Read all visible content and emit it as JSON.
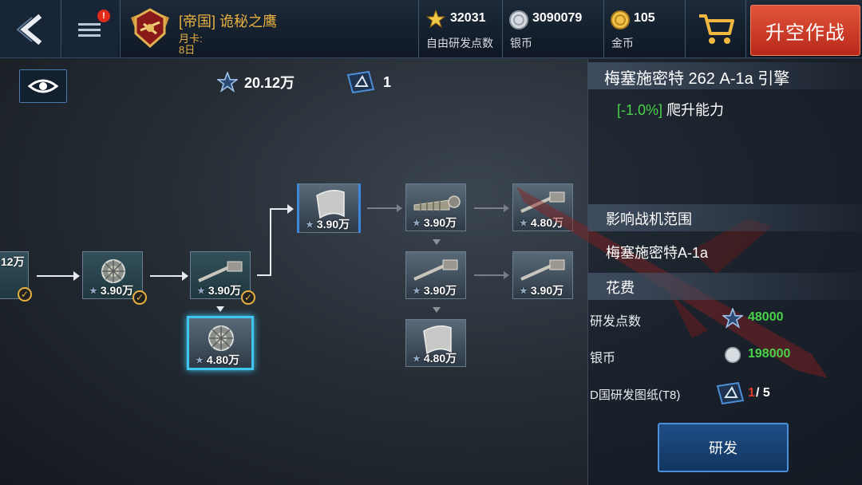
{
  "topbar": {
    "player": {
      "faction": "[帝国]",
      "name": "诡秘之鹰",
      "monthly_card_label": "月卡:",
      "monthly_card_days": "8日"
    },
    "menu_notification": "!",
    "resources": [
      {
        "value": "32031",
        "label": "自由研发点数",
        "icon": "star-icon"
      },
      {
        "value": "3090079",
        "label": "银币",
        "icon": "silver-coin-icon"
      },
      {
        "value": "105",
        "label": "金币",
        "icon": "gold-coin-icon"
      }
    ],
    "fight_button": "升空作战"
  },
  "tree_header": {
    "research_points": "20.12万",
    "blueprints": "1"
  },
  "tree": {
    "nodes": [
      {
        "id": "n0",
        "cost": "12万",
        "state": "researched"
      },
      {
        "id": "n1",
        "cost": "3.90万",
        "state": "researched",
        "icon": "engine-icon"
      },
      {
        "id": "n2",
        "cost": "3.90万",
        "state": "researched",
        "icon": "cannon-icon"
      },
      {
        "id": "n3",
        "cost": "4.80万",
        "state": "selected",
        "icon": "engine-icon"
      },
      {
        "id": "n4",
        "cost": "3.90万",
        "state": "available",
        "icon": "armor-plate-icon"
      },
      {
        "id": "n5",
        "cost": "3.90万",
        "state": "locked",
        "icon": "propeller-engine-icon"
      },
      {
        "id": "n6",
        "cost": "3.90万",
        "state": "locked",
        "icon": "cannon-icon"
      },
      {
        "id": "n7",
        "cost": "4.80万",
        "state": "locked",
        "icon": "armor-plate-icon"
      },
      {
        "id": "n8",
        "cost": "4.80万",
        "state": "locked",
        "icon": "cannon-icon"
      },
      {
        "id": "n9",
        "cost": "3.90万",
        "state": "locked",
        "icon": "cannon-icon"
      }
    ]
  },
  "panel": {
    "title": "梅塞施密特 262 A-1a 引擎",
    "effect_value": "[-1.0%]",
    "effect_label": "爬升能力",
    "range_header": "影响战机范围",
    "aircraft": "梅塞施密特A-1a",
    "cost_header": "花费",
    "costs": [
      {
        "label": "研发点数",
        "value": "48000",
        "icon": "star-icon"
      },
      {
        "label": "银币",
        "value": "198000",
        "icon": "silver-coin-icon"
      }
    ],
    "blueprint_label": "D国研发图纸(T8)",
    "blueprint_have": "1",
    "blueprint_need": "/ 5",
    "research_button": "研发"
  },
  "colors": {
    "accent_blue": "#4d8ed8",
    "green": "#4ad24a",
    "red": "#e03a2a",
    "gold": "#e8b040"
  }
}
